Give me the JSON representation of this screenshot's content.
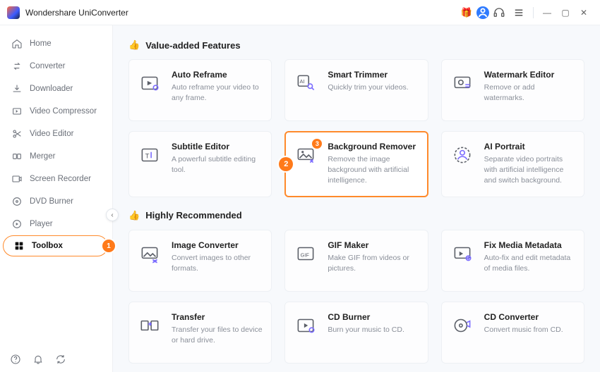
{
  "app": {
    "title": "Wondershare UniConverter"
  },
  "titlebar": {
    "gift_icon": "🎁"
  },
  "sidebar": {
    "items": [
      {
        "label": "Home",
        "icon": "home-icon"
      },
      {
        "label": "Converter",
        "icon": "converter-icon"
      },
      {
        "label": "Downloader",
        "icon": "download-icon"
      },
      {
        "label": "Video Compressor",
        "icon": "compress-icon"
      },
      {
        "label": "Video Editor",
        "icon": "scissors-icon"
      },
      {
        "label": "Merger",
        "icon": "merge-icon"
      },
      {
        "label": "Screen Recorder",
        "icon": "record-icon"
      },
      {
        "label": "DVD Burner",
        "icon": "dvd-icon"
      },
      {
        "label": "Player",
        "icon": "play-icon"
      },
      {
        "label": "Toolbox",
        "icon": "toolbox-icon"
      }
    ],
    "active_index": 9,
    "active_badge": "1"
  },
  "sections": {
    "value_added": {
      "title": "Value-added Features",
      "cards": [
        {
          "title": "Auto Reframe",
          "desc": "Auto reframe your video to any frame.",
          "icon": "reframe-icon"
        },
        {
          "title": "Smart Trimmer",
          "desc": "Quickly trim your videos.",
          "icon": "smart-trimmer-icon"
        },
        {
          "title": "Watermark Editor",
          "desc": "Remove or add watermarks.",
          "icon": "watermark-icon"
        },
        {
          "title": "Subtitle Editor",
          "desc": "A powerful subtitle editing tool.",
          "icon": "subtitle-icon"
        },
        {
          "title": "Background Remover",
          "desc": "Remove the image background with artificial intelligence.",
          "icon": "bg-remover-icon",
          "highlight_badge": "2",
          "icon_badge": "3"
        },
        {
          "title": "AI Portrait",
          "desc": "Separate video portraits with artificial intelligence and switch background.",
          "icon": "ai-portrait-icon"
        }
      ]
    },
    "recommended": {
      "title": "Highly Recommended",
      "cards": [
        {
          "title": "Image Converter",
          "desc": "Convert images to other formats.",
          "icon": "image-convert-icon"
        },
        {
          "title": "GIF Maker",
          "desc": "Make GIF from videos or pictures.",
          "icon": "gif-icon"
        },
        {
          "title": "Fix Media Metadata",
          "desc": "Auto-fix and edit metadata of media files.",
          "icon": "metadata-icon"
        },
        {
          "title": "Transfer",
          "desc": "Transfer your files to device or hard drive.",
          "icon": "transfer-icon"
        },
        {
          "title": "CD Burner",
          "desc": "Burn your music to CD.",
          "icon": "cd-burner-icon"
        },
        {
          "title": "CD Converter",
          "desc": "Convert music from CD.",
          "icon": "cd-convert-icon"
        }
      ]
    }
  }
}
